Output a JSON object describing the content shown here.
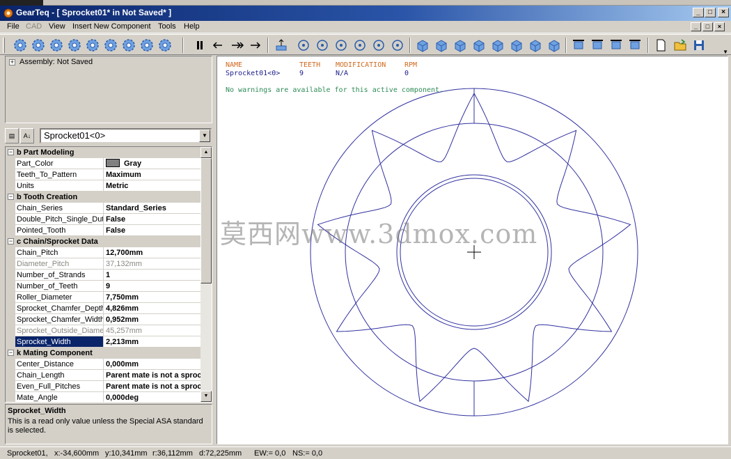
{
  "window": {
    "title": "GearTeq - [ Sprocket01*  in  Not Saved* ]",
    "buttons": {
      "minimize": "_",
      "maximize": "□",
      "close": "×"
    }
  },
  "menu": [
    "File",
    "CAD",
    "View",
    "Insert New Component",
    "Tools",
    "Help"
  ],
  "menu_disabled": [
    "CAD"
  ],
  "toolbar": {
    "icons": [
      "spur-gear-icon",
      "helical-gear-icon",
      "internal-gear-icon",
      "worm-icon",
      "rack-icon",
      "sprocket-icon",
      "chain-icon",
      "pulley-icon",
      "belt-icon",
      "pause-icon",
      "step-back-icon",
      "fast-forward-icon",
      "step-forward-icon",
      "export-icon",
      "zoom-fit-icon",
      "zoom-window-icon",
      "zoom-in-icon",
      "rotate-icon",
      "pan-icon",
      "center-view-icon",
      "view-front-icon",
      "view-back-icon",
      "view-top-icon",
      "view-bottom-icon",
      "view-left-icon",
      "view-right-icon",
      "view-iso-icon",
      "view-normal-icon",
      "align-top-icon",
      "align-bottom-icon",
      "align-left-icon",
      "align-right-icon",
      "new-file-icon",
      "open-file-icon",
      "save-icon"
    ]
  },
  "tree": {
    "expander": "+",
    "label": "Assembly: Not Saved"
  },
  "component_select": {
    "value": "Sprocket01<0>"
  },
  "properties": [
    {
      "type": "cat",
      "label": "b Part Modeling"
    },
    {
      "type": "row",
      "name": "Part_Color",
      "value": "Gray",
      "swatch": true
    },
    {
      "type": "row",
      "name": "Teeth_To_Pattern",
      "value": "Maximum"
    },
    {
      "type": "row",
      "name": "Units",
      "value": "Metric"
    },
    {
      "type": "cat",
      "label": "b Tooth Creation"
    },
    {
      "type": "row",
      "name": "Chain_Series",
      "value": "Standard_Series"
    },
    {
      "type": "row",
      "name": "Double_Pitch_Single_Duty",
      "value": "False"
    },
    {
      "type": "row",
      "name": "Pointed_Tooth",
      "value": "False"
    },
    {
      "type": "cat",
      "label": "c Chain/Sprocket Data"
    },
    {
      "type": "row",
      "name": "Chain_Pitch",
      "value": "12,700mm"
    },
    {
      "type": "row",
      "name": "Diameter_Pitch",
      "value": "37,132mm",
      "readonly": true
    },
    {
      "type": "row",
      "name": "Number_of_Strands",
      "value": "1"
    },
    {
      "type": "row",
      "name": "Number_of_Teeth",
      "value": "9"
    },
    {
      "type": "row",
      "name": "Roller_Diameter",
      "value": "7,750mm"
    },
    {
      "type": "row",
      "name": "Sprocket_Chamfer_Depth",
      "value": "4,826mm"
    },
    {
      "type": "row",
      "name": "Sprocket_Chamfer_Width",
      "value": "0,952mm"
    },
    {
      "type": "row",
      "name": "Sprocket_Outside_Diameter",
      "value": "45,257mm",
      "readonly": true
    },
    {
      "type": "row",
      "name": "Sprocket_Width",
      "value": "2,213mm",
      "selected": true
    },
    {
      "type": "cat",
      "label": "k Mating Component"
    },
    {
      "type": "row",
      "name": "Center_Distance",
      "value": "0,000mm"
    },
    {
      "type": "row",
      "name": "Chain_Length",
      "value": "Parent mate is not a sprocket"
    },
    {
      "type": "row",
      "name": "Even_Full_Pitches",
      "value": "Parent mate is not a sprocket"
    },
    {
      "type": "row",
      "name": "Mate_Angle",
      "value": "0,000deg"
    }
  ],
  "help": {
    "title": "Sprocket_Width",
    "text": "This is a read only value unless the Special ASA standard is selected."
  },
  "info_table": {
    "headers": [
      "NAME",
      "TEETH",
      "MODIFICATION",
      "RPM"
    ],
    "values": [
      "Sprocket01<0>",
      "9",
      "N/A",
      "0"
    ]
  },
  "warning": "No warnings are available for this active component.",
  "watermark": "莫西网www.3dmox.com",
  "gear": {
    "teeth": 9,
    "line_color": "#3030a0"
  },
  "status": {
    "component": "Sprocket01,",
    "x": "x:-34,600mm",
    "y": "y:10,341mm",
    "r": "r:36,112mm",
    "d": "d:72,225mm",
    "ew": "EW:= 0,0",
    "ns": "NS:= 0,0"
  }
}
